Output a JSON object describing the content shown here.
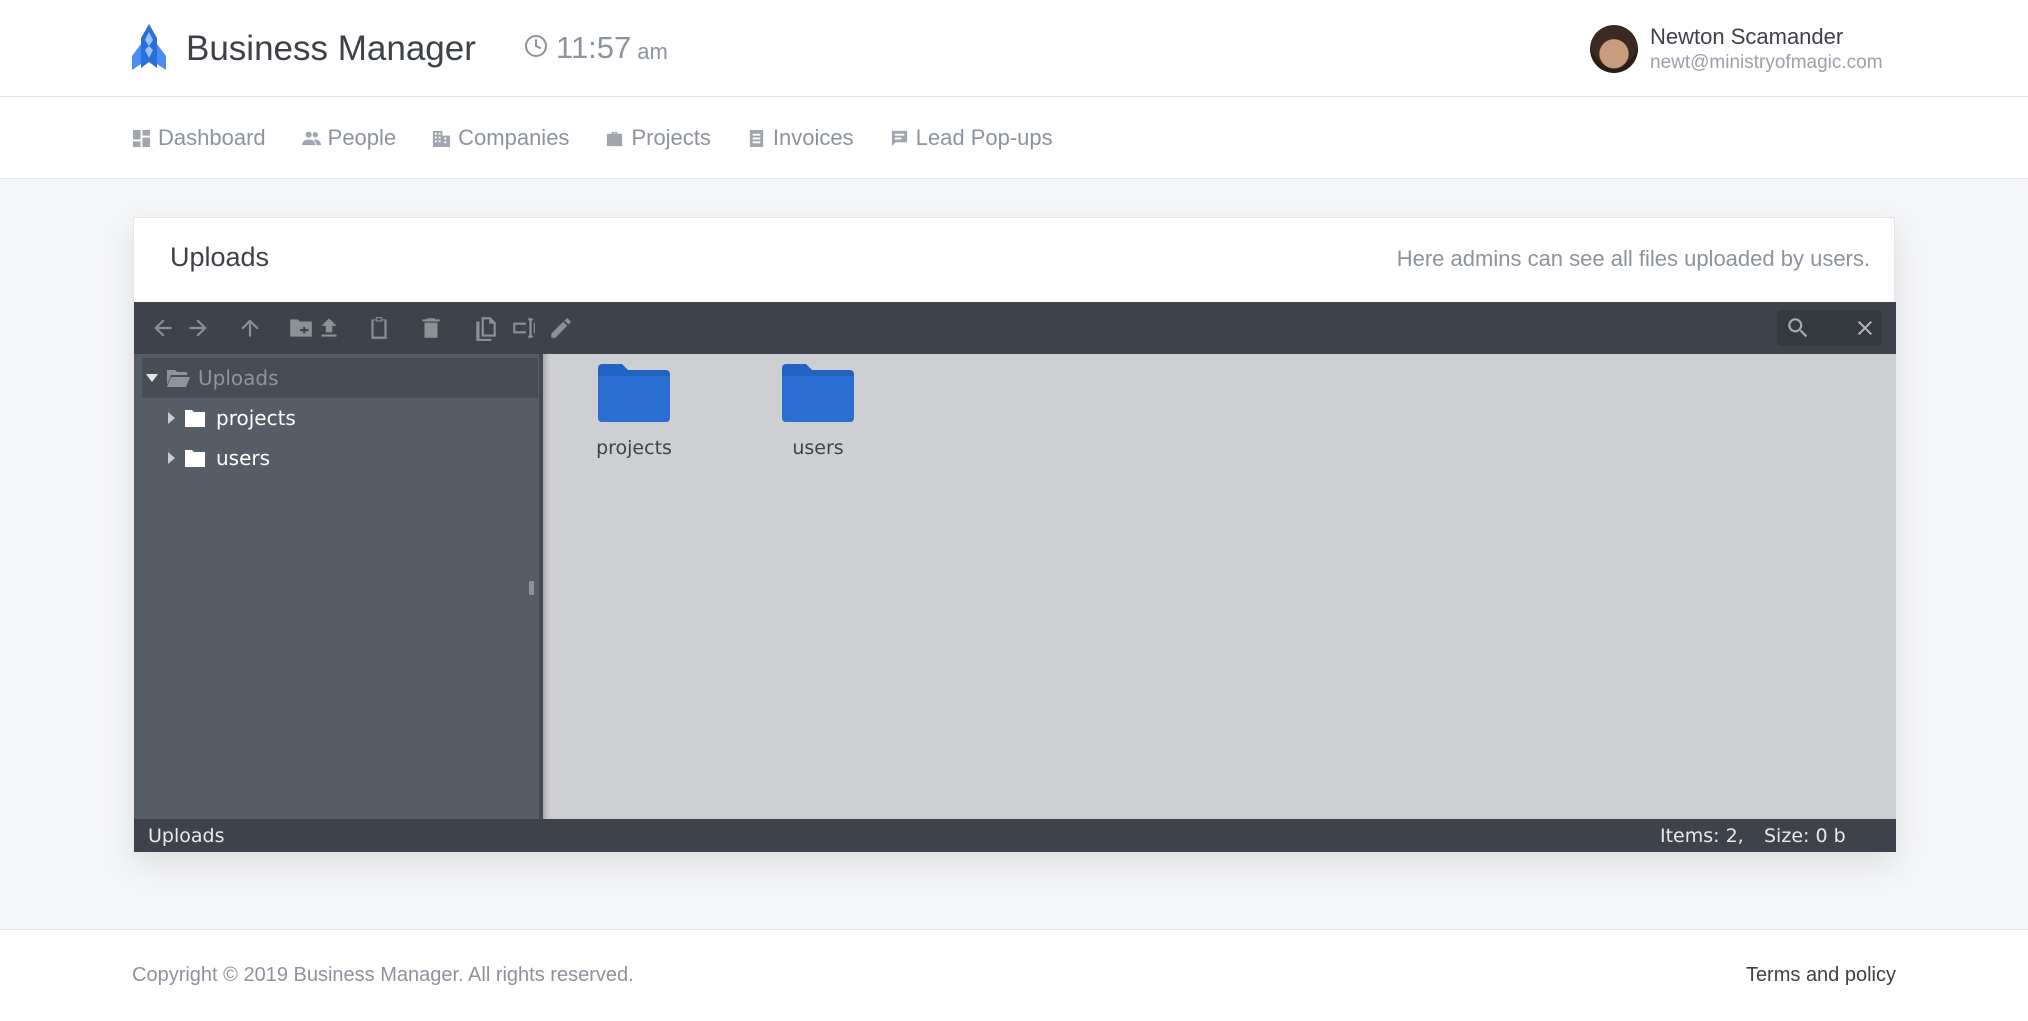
{
  "header": {
    "app_name": "Business Manager",
    "time": "11:57",
    "ampm": "am",
    "user": {
      "name": "Newton Scamander",
      "email": "newt@ministryofmagic.com"
    }
  },
  "nav": {
    "items": [
      {
        "label": "Dashboard",
        "icon": "dashboard-icon"
      },
      {
        "label": "People",
        "icon": "people-icon"
      },
      {
        "label": "Companies",
        "icon": "companies-icon"
      },
      {
        "label": "Projects",
        "icon": "briefcase-icon"
      },
      {
        "label": "Invoices",
        "icon": "invoice-icon"
      },
      {
        "label": "Lead Pop-ups",
        "icon": "chat-icon"
      }
    ]
  },
  "card": {
    "title": "Uploads",
    "description": "Here admins can see all files uploaded by users."
  },
  "file_manager": {
    "toolbar_icons": [
      "back-icon",
      "forward-icon",
      "up-icon",
      "new-folder-icon",
      "upload-icon",
      "paste-icon",
      "delete-icon",
      "copy-icon",
      "rename-icon",
      "edit-icon"
    ],
    "search": {
      "placeholder": ""
    },
    "tree": {
      "root": "Uploads",
      "children": [
        "projects",
        "users"
      ]
    },
    "items": [
      "projects",
      "users"
    ],
    "status": {
      "path": "Uploads",
      "items": "Items: 2,",
      "size": "Size: 0 b"
    },
    "colors": {
      "toolbar": "#3e434b",
      "tree": "#565d66",
      "content": "#cecfd3",
      "folder": "#2163c0"
    }
  },
  "footer": {
    "copyright": "Copyright © 2019 Business Manager. All rights reserved.",
    "terms": "Terms and policy"
  }
}
